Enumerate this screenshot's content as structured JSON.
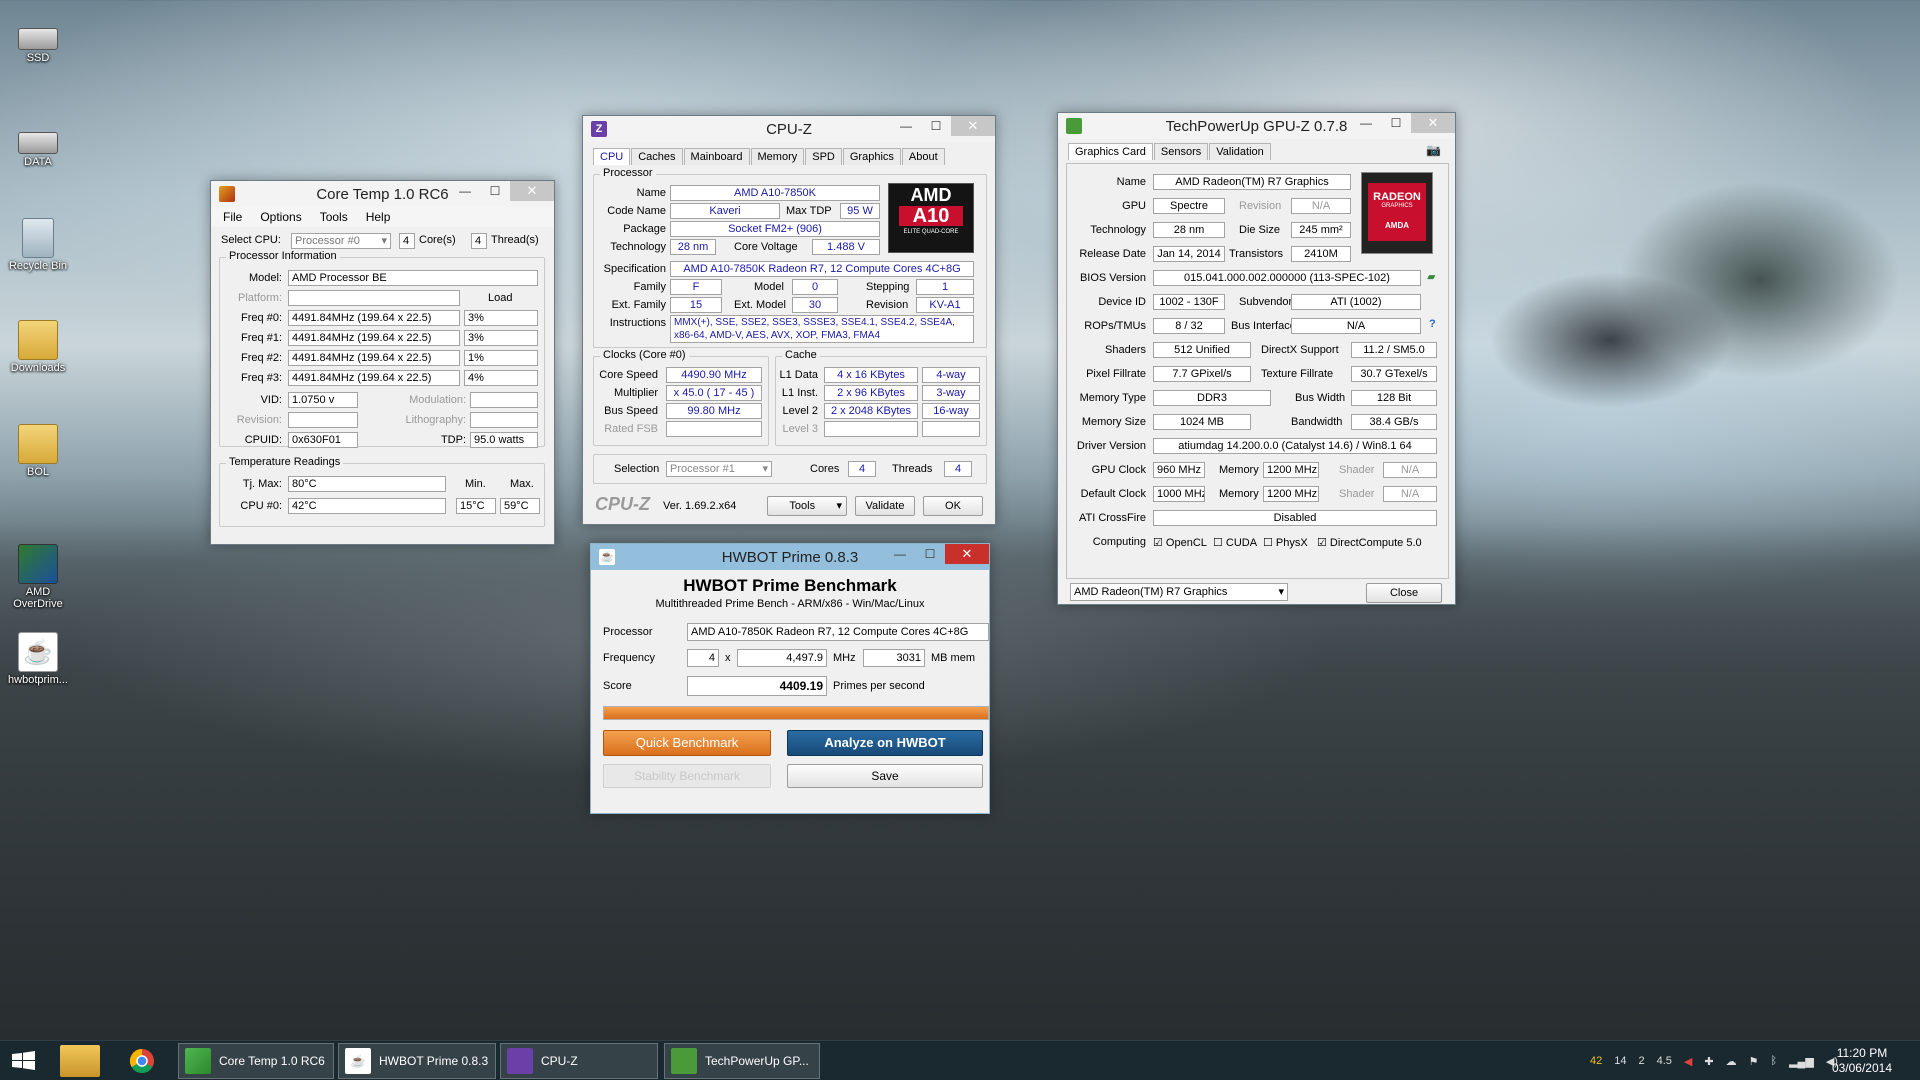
{
  "desktop": {
    "icons": [
      {
        "label": "SSD"
      },
      {
        "label": "DATA"
      },
      {
        "label": "Recycle Bin"
      },
      {
        "label": "Downloads"
      },
      {
        "label": "BOL"
      },
      {
        "label": "AMD OverDrive"
      },
      {
        "label": "hwbotprim..."
      }
    ]
  },
  "coretemp": {
    "title": "Core Temp 1.0 RC6",
    "menu": [
      "File",
      "Options",
      "Tools",
      "Help"
    ],
    "select_cpu_label": "Select CPU:",
    "select_cpu_value": "Processor #0",
    "cores": "4",
    "cores_label": "Core(s)",
    "threads": "4",
    "threads_label": "Thread(s)",
    "proc_info_label": "Processor Information",
    "model_label": "Model:",
    "model": "AMD Processor  BE",
    "platform_label": "Platform:",
    "load_label": "Load",
    "freqs": [
      {
        "label": "Freq #0:",
        "value": "4491.84MHz (199.64 x 22.5)",
        "load": "3%"
      },
      {
        "label": "Freq #1:",
        "value": "4491.84MHz (199.64 x 22.5)",
        "load": "3%"
      },
      {
        "label": "Freq #2:",
        "value": "4491.84MHz (199.64 x 22.5)",
        "load": "1%"
      },
      {
        "label": "Freq #3:",
        "value": "4491.84MHz (199.64 x 22.5)",
        "load": "4%"
      }
    ],
    "vid_label": "VID:",
    "vid": "1.0750 v",
    "modulation_label": "Modulation:",
    "revision_label": "Revision:",
    "lithography_label": "Lithography:",
    "cpuid_label": "CPUID:",
    "cpuid": "0x630F01",
    "tdp_label": "TDP:",
    "tdp": "95.0 watts",
    "temp_label": "Temperature Readings",
    "tjmax_label": "Tj. Max:",
    "tjmax": "80°C",
    "min_label": "Min.",
    "max_label": "Max.",
    "cpu0_label": "CPU #0:",
    "cpu0": "42°C",
    "cpu0_min": "15°C",
    "cpu0_max": "59°C"
  },
  "cpuz": {
    "title": "CPU-Z",
    "tabs": [
      "CPU",
      "Caches",
      "Mainboard",
      "Memory",
      "SPD",
      "Graphics",
      "About"
    ],
    "processor_label": "Processor",
    "name_label": "Name",
    "name": "AMD A10-7850K",
    "codename_label": "Code Name",
    "codename": "Kaveri",
    "maxtdp_label": "Max TDP",
    "maxtdp": "95 W",
    "package_label": "Package",
    "package": "Socket FM2+ (906)",
    "technology_label": "Technology",
    "technology": "28 nm",
    "corevoltage_label": "Core Voltage",
    "corevoltage": "1.488 V",
    "spec_label": "Specification",
    "spec": "AMD A10-7850K Radeon R7, 12 Compute Cores 4C+8G",
    "family_label": "Family",
    "family": "F",
    "model_label": "Model",
    "model": "0",
    "stepping_label": "Stepping",
    "stepping": "1",
    "extfamily_label": "Ext. Family",
    "extfamily": "15",
    "extmodel_label": "Ext. Model",
    "extmodel": "30",
    "revision_label": "Revision",
    "revision": "KV-A1",
    "instructions_label": "Instructions",
    "instructions": "MMX(+), SSE, SSE2, SSE3, SSSE3, SSE4.1, SSE4.2, SSE4A, x86-64, AMD-V, AES, AVX, XOP, FMA3, FMA4",
    "logo_brand": "AMD",
    "logo_model": "A10",
    "logo_sub": "ELITE QUAD-CORE",
    "clocks_label": "Clocks (Core #0)",
    "corespeed_label": "Core Speed",
    "corespeed": "4490.90 MHz",
    "multiplier_label": "Multiplier",
    "multiplier": "x 45.0 ( 17 - 45 )",
    "busspeed_label": "Bus Speed",
    "busspeed": "99.80 MHz",
    "ratedfsb_label": "Rated FSB",
    "cache_label": "Cache",
    "l1data_label": "L1 Data",
    "l1data": "4 x 16 KBytes",
    "l1data_way": "4-way",
    "l1inst_label": "L1 Inst.",
    "l1inst": "2 x 96 KBytes",
    "l1inst_way": "3-way",
    "level2_label": "Level 2",
    "level2": "2 x 2048 KBytes",
    "level2_way": "16-way",
    "level3_label": "Level 3",
    "selection_label": "Selection",
    "selection": "Processor #1",
    "cores_label": "Cores",
    "cores": "4",
    "threads_label": "Threads",
    "threads": "4",
    "brand": "CPU-Z",
    "version": "Ver. 1.69.2.x64",
    "tools_label": "Tools",
    "validate_label": "Validate",
    "ok_label": "OK"
  },
  "gpuz": {
    "title": "TechPowerUp GPU-Z 0.7.8",
    "tabs": [
      "Graphics Card",
      "Sensors",
      "Validation"
    ],
    "rows": {
      "name_label": "Name",
      "name": "AMD Radeon(TM) R7 Graphics",
      "gpu_label": "GPU",
      "gpu": "Spectre",
      "revision_label": "Revision",
      "revision": "N/A",
      "technology_label": "Technology",
      "technology": "28 nm",
      "diesize_label": "Die Size",
      "diesize": "245 mm²",
      "release_label": "Release Date",
      "release": "Jan 14, 2014",
      "transistors_label": "Transistors",
      "transistors": "2410M",
      "bios_label": "BIOS Version",
      "bios": "015.041.000.002.000000 (113-SPEC-102)",
      "deviceid_label": "Device ID",
      "deviceid": "1002 - 130F",
      "subvendor_label": "Subvendor",
      "subvendor": "ATI (1002)",
      "rops_label": "ROPs/TMUs",
      "rops": "8 / 32",
      "businterface_label": "Bus Interface",
      "businterface": "N/A",
      "shaders_label": "Shaders",
      "shaders": "512 Unified",
      "directx_label": "DirectX Support",
      "directx": "11.2 / SM5.0",
      "pixel_label": "Pixel Fillrate",
      "pixel": "7.7 GPixel/s",
      "texture_label": "Texture Fillrate",
      "texture": "30.7 GTexel/s",
      "memtype_label": "Memory Type",
      "memtype": "DDR3",
      "buswidth_label": "Bus Width",
      "buswidth": "128 Bit",
      "memsize_label": "Memory Size",
      "memsize": "1024 MB",
      "bandwidth_label": "Bandwidth",
      "bandwidth": "38.4 GB/s",
      "driver_label": "Driver Version",
      "driver": "atiumdag 14.200.0.0 (Catalyst 14.6) / Win8.1 64",
      "gpuclock_label": "GPU Clock",
      "gpuclock": "960 MHz",
      "memory_label": "Memory",
      "gpuclock_mem": "1200 MHz",
      "shader_label": "Shader",
      "gpuclock_shader": "N/A",
      "defclock_label": "Default Clock",
      "defclock": "1000 MHz",
      "defclock_mem": "1200 MHz",
      "defclock_shader": "N/A",
      "crossfire_label": "ATI CrossFire",
      "crossfire": "Disabled",
      "computing_label": "Computing",
      "opencl": "OpenCL",
      "cuda": "CUDA",
      "physx": "PhysX",
      "directcompute": "DirectCompute 5.0"
    },
    "logo_top": "RADEON",
    "logo_mid": "GRAPHICS",
    "logo_bot": "AMDA",
    "select": "AMD Radeon(TM) R7 Graphics",
    "close_label": "Close"
  },
  "hwbot": {
    "title": "HWBOT Prime 0.8.3",
    "heading": "HWBOT Prime Benchmark",
    "subheading": "Multithreaded Prime Bench - ARM/x86 - Win/Mac/Linux",
    "processor_label": "Processor",
    "processor": "AMD A10-7850K Radeon R7, 12 Compute Cores 4C+8G",
    "frequency_label": "Frequency",
    "freq_cores": "4",
    "freq_x": "x",
    "freq_mhz": "4,497.9",
    "mhz_label": "MHz",
    "mem": "3031",
    "mem_label": "MB mem",
    "score_label": "Score",
    "score": "4409.19",
    "score_unit": "Primes per second",
    "progress": 1.0,
    "quick_label": "Quick Benchmark",
    "analyze_label": "Analyze on HWBOT",
    "stability_label": "Stability Benchmark",
    "save_label": "Save"
  },
  "taskbar": {
    "tasks": [
      {
        "label": "Core Temp 1.0 RC6"
      },
      {
        "label": "HWBOT Prime 0.8.3"
      },
      {
        "label": "CPU-Z"
      },
      {
        "label": "TechPowerUp GP..."
      }
    ],
    "tray_temps": [
      "42",
      "14",
      "2",
      "4.5"
    ],
    "time": "11:20 PM",
    "date": "03/06/2014"
  },
  "colors": {
    "amd_red": "#c8102e",
    "hwbot_orange": "#e8822a",
    "hwbot_blue": "#1e5a8c",
    "cpuz_blue": "#1a1aa8"
  }
}
